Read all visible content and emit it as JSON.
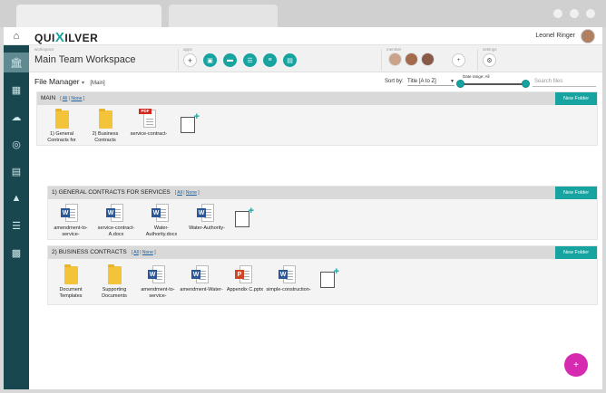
{
  "topbar": {
    "logo_pre": "QUI",
    "logo_x": "X",
    "logo_post": "ILVER",
    "user_name": "Leonel Ringer"
  },
  "workspace": {
    "label": "workspace",
    "title": "Main Team Workspace",
    "apps_label": "apps",
    "member_label": "member",
    "settings_label": "settings"
  },
  "file_manager": {
    "title": "File Manager",
    "caret": "▾",
    "context": "[Main]",
    "sort_label": "Sort by:",
    "sort_value": "Title [A to Z]",
    "date_range_label": "Date range: All",
    "search_placeholder": "Search files"
  },
  "sections": [
    {
      "title": "MAIN",
      "all": "All",
      "sep": "|",
      "none": "None",
      "new_folder": "New Folder",
      "files": [
        {
          "name": "1) General Contracts for",
          "type": "folder"
        },
        {
          "name": "2) Business Contracts",
          "type": "folder"
        },
        {
          "name": "service-contract-",
          "type": "pdf",
          "badge": "PDF"
        }
      ]
    },
    {
      "title": "1) GENERAL CONTRACTS FOR SERVICES",
      "all": "All",
      "sep": "|",
      "none": "None",
      "new_folder": "New Folder",
      "files": [
        {
          "name": "amendment-to-service-",
          "type": "word",
          "badge": "W"
        },
        {
          "name": "service-contract-A.docx",
          "type": "word",
          "badge": "W"
        },
        {
          "name": "Water-Authority.docx",
          "type": "word",
          "badge": "W"
        },
        {
          "name": "Water-Authority-",
          "type": "word",
          "badge": "W"
        }
      ]
    },
    {
      "title": "2) BUSINESS CONTRACTS",
      "all": "All",
      "sep": "|",
      "none": "None",
      "new_folder": "New Folder",
      "files": [
        {
          "name": "Document Templates",
          "type": "folder"
        },
        {
          "name": "Supporting Documents",
          "type": "folder"
        },
        {
          "name": "amendment-to-service-",
          "type": "word",
          "badge": "W"
        },
        {
          "name": "amendment-Water-",
          "type": "word",
          "badge": "W"
        },
        {
          "name": "Appendix C.pptx",
          "type": "ppt",
          "badge": "P"
        },
        {
          "name": "simple-construction-",
          "type": "word",
          "badge": "W"
        }
      ]
    }
  ],
  "icons": {
    "home": "home-icon",
    "sidebar": [
      "bank-icon",
      "grid-icon",
      "cloud-icon",
      "lifebuoy-icon",
      "id-card-icon",
      "org-chart-icon",
      "database-icon",
      "table-icon"
    ],
    "apps": [
      "chat-icon",
      "folder-icon",
      "list-icon",
      "tasks-icon",
      "document-icon"
    ]
  },
  "fab": {
    "symbol": "+"
  },
  "colors": {
    "accent": "#17a3a0",
    "sidebar": "#18474f",
    "fab": "#d62bb0",
    "word": "#2b5797",
    "pdf": "#d8261f",
    "ppt": "#d04525",
    "folder": "#f3c33a"
  }
}
